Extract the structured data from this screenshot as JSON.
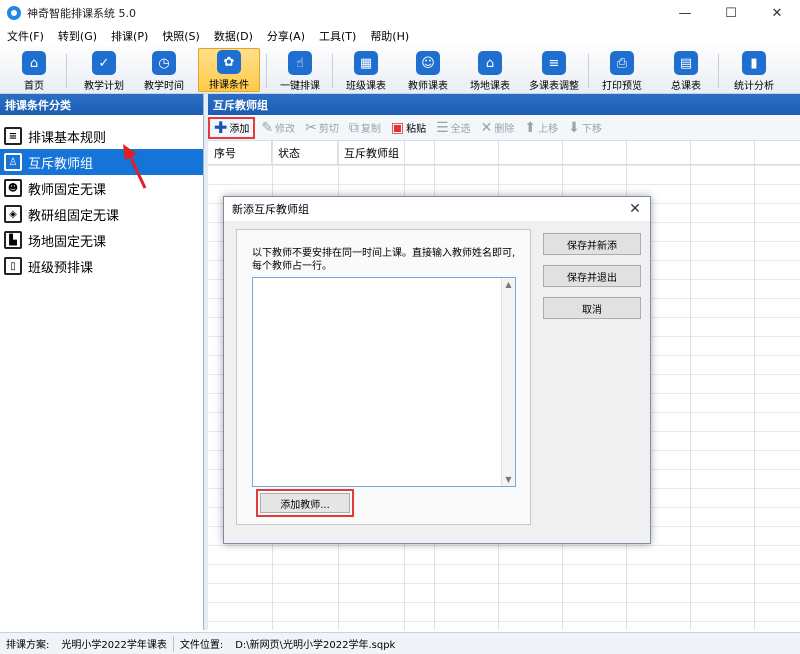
{
  "window": {
    "title": "神奇智能排课系统 5.0",
    "controls": {
      "minimize": "—",
      "maximize": "☐",
      "close": "✕"
    }
  },
  "menu": [
    "文件(F)",
    "转到(G)",
    "排课(P)",
    "快照(S)",
    "数据(D)",
    "分享(A)",
    "工具(T)",
    "帮助(H)"
  ],
  "toolbar": {
    "items": [
      {
        "label": "首页",
        "icon": "home-icon"
      },
      {
        "label": "教学计划",
        "icon": "clipboard-icon"
      },
      {
        "label": "教学时间",
        "icon": "clock-icon"
      },
      {
        "label": "排课条件",
        "icon": "conditions-icon",
        "active": true
      },
      {
        "label": "一键排课",
        "icon": "hand-click-icon"
      },
      {
        "label": "班级课表",
        "icon": "calendar-icon"
      },
      {
        "label": "教师课表",
        "icon": "teacher-schedule-icon"
      },
      {
        "label": "场地课表",
        "icon": "venue-icon"
      },
      {
        "label": "多课表调整",
        "icon": "adjust-icon"
      },
      {
        "label": "打印预览",
        "icon": "printer-icon"
      },
      {
        "label": "总课表",
        "icon": "master-schedule-icon"
      },
      {
        "label": "统计分析",
        "icon": "chart-icon"
      }
    ],
    "active_color": "#ffc94a"
  },
  "left_pane": {
    "header": "排课条件分类",
    "items": [
      {
        "label": "排课基本规则",
        "icon": "rules-icon"
      },
      {
        "label": "互斥教师组",
        "icon": "mutex-group-icon",
        "selected": true
      },
      {
        "label": "教师固定无课",
        "icon": "teacher-icon"
      },
      {
        "label": "教研组固定无课",
        "icon": "cube-icon"
      },
      {
        "label": "场地固定无课",
        "icon": "venue-block-icon"
      },
      {
        "label": "班级预排课",
        "icon": "book-icon"
      }
    ]
  },
  "right_pane": {
    "header": "互斥教师组",
    "actions": [
      {
        "label": "添加",
        "enabled": true
      },
      {
        "label": "修改",
        "enabled": false
      },
      {
        "label": "剪切",
        "enabled": false
      },
      {
        "label": "复制",
        "enabled": false
      },
      {
        "label": "粘贴",
        "enabled": true
      },
      {
        "label": "全选",
        "enabled": false
      },
      {
        "label": "删除",
        "enabled": false
      },
      {
        "label": "上移",
        "enabled": false
      },
      {
        "label": "下移",
        "enabled": false
      }
    ],
    "columns": [
      "序号",
      "状态",
      "互斥教师组"
    ]
  },
  "dialog": {
    "title": "新添互斥教师组",
    "message_line1": "以下教师不要安排在同一时间上课。直接输入教师姓名即可,",
    "message_line2": "每个教师占一行。",
    "textarea_value": "",
    "add_teacher_label": "添加教师...",
    "buttons": {
      "save_new": "保存并新添",
      "save_exit": "保存并退出",
      "cancel": "取消"
    }
  },
  "status": {
    "plan_label": "排课方案:",
    "plan_value": "光明小学2022学年课表",
    "file_label": "文件位置:",
    "file_value": "D:\\新网页\\光明小学2022学年.sqpk"
  },
  "colors": {
    "brand": "#1f6fd0",
    "selection": "#1673d8",
    "highlight_border": "#e23b3b"
  }
}
